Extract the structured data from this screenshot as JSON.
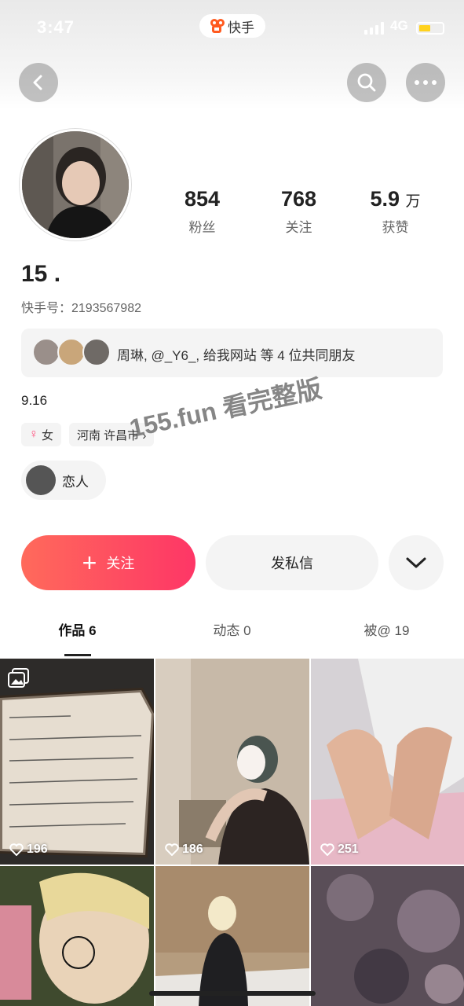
{
  "status_bar": {
    "time": "3:47",
    "app_name": "快手",
    "network": "4G"
  },
  "profile": {
    "followers_count": "854",
    "followers_label": "粉丝",
    "following_count": "768",
    "following_label": "关注",
    "likes_count": "5.9",
    "likes_unit": "万",
    "likes_label": "获赞",
    "nickname": "15 .",
    "kuaishou_id": "快手号：2193567982",
    "mutual_friends": "周琳, @_Y6_, 给我网站 等 4 位共同朋友",
    "bio": "9.16",
    "gender_icon": "♀",
    "gender": "女",
    "location": "河南 许昌市 ›",
    "relationship": "恋人"
  },
  "watermark": "155.fun 看完整版",
  "actions": {
    "follow_label": "关注",
    "message_label": "发私信"
  },
  "tabs": [
    {
      "label": "作品 6"
    },
    {
      "label": "动态 0"
    },
    {
      "label": "被@ 19"
    }
  ],
  "posts": [
    {
      "likes": "196"
    },
    {
      "likes": "186"
    },
    {
      "likes": "251"
    }
  ],
  "colors": {
    "accent": "#fe3666",
    "follow_gradient_start": "#ff6a5b",
    "tab_text": "#555555"
  }
}
